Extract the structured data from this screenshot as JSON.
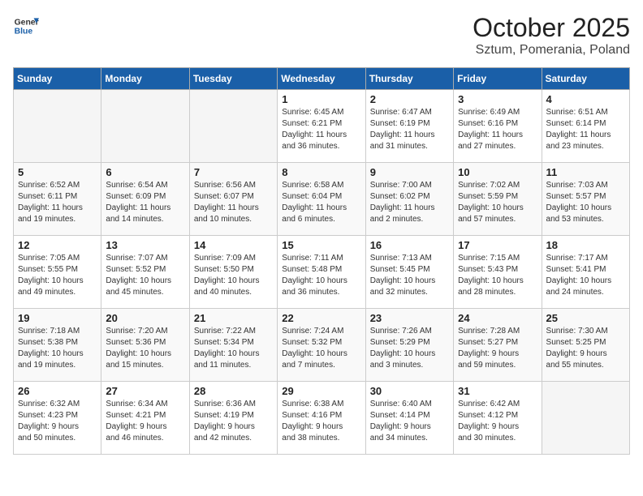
{
  "logo": {
    "line1": "General",
    "line2": "Blue"
  },
  "title": "October 2025",
  "location": "Sztum, Pomerania, Poland",
  "weekdays": [
    "Sunday",
    "Monday",
    "Tuesday",
    "Wednesday",
    "Thursday",
    "Friday",
    "Saturday"
  ],
  "weeks": [
    [
      {
        "day": "",
        "info": ""
      },
      {
        "day": "",
        "info": ""
      },
      {
        "day": "",
        "info": ""
      },
      {
        "day": "1",
        "info": "Sunrise: 6:45 AM\nSunset: 6:21 PM\nDaylight: 11 hours\nand 36 minutes."
      },
      {
        "day": "2",
        "info": "Sunrise: 6:47 AM\nSunset: 6:19 PM\nDaylight: 11 hours\nand 31 minutes."
      },
      {
        "day": "3",
        "info": "Sunrise: 6:49 AM\nSunset: 6:16 PM\nDaylight: 11 hours\nand 27 minutes."
      },
      {
        "day": "4",
        "info": "Sunrise: 6:51 AM\nSunset: 6:14 PM\nDaylight: 11 hours\nand 23 minutes."
      }
    ],
    [
      {
        "day": "5",
        "info": "Sunrise: 6:52 AM\nSunset: 6:11 PM\nDaylight: 11 hours\nand 19 minutes."
      },
      {
        "day": "6",
        "info": "Sunrise: 6:54 AM\nSunset: 6:09 PM\nDaylight: 11 hours\nand 14 minutes."
      },
      {
        "day": "7",
        "info": "Sunrise: 6:56 AM\nSunset: 6:07 PM\nDaylight: 11 hours\nand 10 minutes."
      },
      {
        "day": "8",
        "info": "Sunrise: 6:58 AM\nSunset: 6:04 PM\nDaylight: 11 hours\nand 6 minutes."
      },
      {
        "day": "9",
        "info": "Sunrise: 7:00 AM\nSunset: 6:02 PM\nDaylight: 11 hours\nand 2 minutes."
      },
      {
        "day": "10",
        "info": "Sunrise: 7:02 AM\nSunset: 5:59 PM\nDaylight: 10 hours\nand 57 minutes."
      },
      {
        "day": "11",
        "info": "Sunrise: 7:03 AM\nSunset: 5:57 PM\nDaylight: 10 hours\nand 53 minutes."
      }
    ],
    [
      {
        "day": "12",
        "info": "Sunrise: 7:05 AM\nSunset: 5:55 PM\nDaylight: 10 hours\nand 49 minutes."
      },
      {
        "day": "13",
        "info": "Sunrise: 7:07 AM\nSunset: 5:52 PM\nDaylight: 10 hours\nand 45 minutes."
      },
      {
        "day": "14",
        "info": "Sunrise: 7:09 AM\nSunset: 5:50 PM\nDaylight: 10 hours\nand 40 minutes."
      },
      {
        "day": "15",
        "info": "Sunrise: 7:11 AM\nSunset: 5:48 PM\nDaylight: 10 hours\nand 36 minutes."
      },
      {
        "day": "16",
        "info": "Sunrise: 7:13 AM\nSunset: 5:45 PM\nDaylight: 10 hours\nand 32 minutes."
      },
      {
        "day": "17",
        "info": "Sunrise: 7:15 AM\nSunset: 5:43 PM\nDaylight: 10 hours\nand 28 minutes."
      },
      {
        "day": "18",
        "info": "Sunrise: 7:17 AM\nSunset: 5:41 PM\nDaylight: 10 hours\nand 24 minutes."
      }
    ],
    [
      {
        "day": "19",
        "info": "Sunrise: 7:18 AM\nSunset: 5:38 PM\nDaylight: 10 hours\nand 19 minutes."
      },
      {
        "day": "20",
        "info": "Sunrise: 7:20 AM\nSunset: 5:36 PM\nDaylight: 10 hours\nand 15 minutes."
      },
      {
        "day": "21",
        "info": "Sunrise: 7:22 AM\nSunset: 5:34 PM\nDaylight: 10 hours\nand 11 minutes."
      },
      {
        "day": "22",
        "info": "Sunrise: 7:24 AM\nSunset: 5:32 PM\nDaylight: 10 hours\nand 7 minutes."
      },
      {
        "day": "23",
        "info": "Sunrise: 7:26 AM\nSunset: 5:29 PM\nDaylight: 10 hours\nand 3 minutes."
      },
      {
        "day": "24",
        "info": "Sunrise: 7:28 AM\nSunset: 5:27 PM\nDaylight: 9 hours\nand 59 minutes."
      },
      {
        "day": "25",
        "info": "Sunrise: 7:30 AM\nSunset: 5:25 PM\nDaylight: 9 hours\nand 55 minutes."
      }
    ],
    [
      {
        "day": "26",
        "info": "Sunrise: 6:32 AM\nSunset: 4:23 PM\nDaylight: 9 hours\nand 50 minutes."
      },
      {
        "day": "27",
        "info": "Sunrise: 6:34 AM\nSunset: 4:21 PM\nDaylight: 9 hours\nand 46 minutes."
      },
      {
        "day": "28",
        "info": "Sunrise: 6:36 AM\nSunset: 4:19 PM\nDaylight: 9 hours\nand 42 minutes."
      },
      {
        "day": "29",
        "info": "Sunrise: 6:38 AM\nSunset: 4:16 PM\nDaylight: 9 hours\nand 38 minutes."
      },
      {
        "day": "30",
        "info": "Sunrise: 6:40 AM\nSunset: 4:14 PM\nDaylight: 9 hours\nand 34 minutes."
      },
      {
        "day": "31",
        "info": "Sunrise: 6:42 AM\nSunset: 4:12 PM\nDaylight: 9 hours\nand 30 minutes."
      },
      {
        "day": "",
        "info": ""
      }
    ]
  ]
}
